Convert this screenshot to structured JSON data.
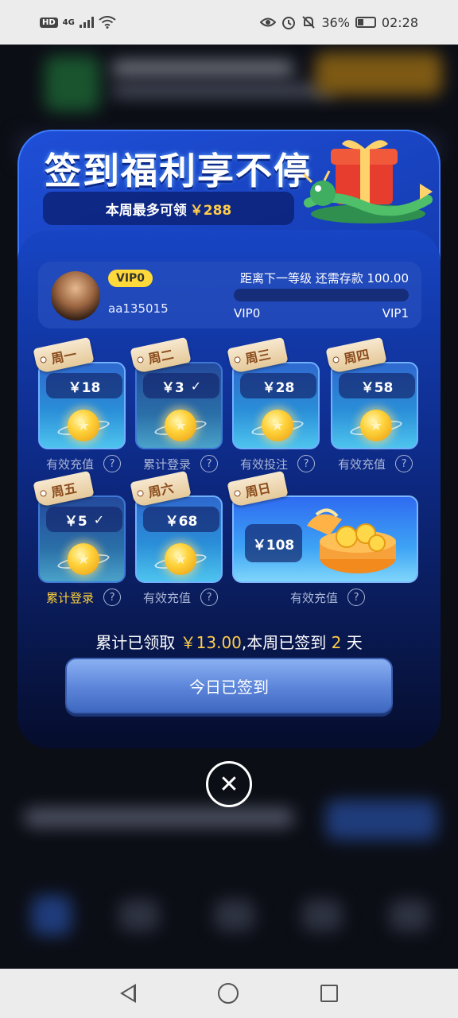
{
  "status_bar": {
    "network": "4G",
    "battery": "36%",
    "time": "02:28"
  },
  "modal": {
    "title": "签到福利享不停",
    "subtitle_prefix": "本周最多可领",
    "subtitle_amount": "￥288",
    "profile": {
      "vip_badge": "VIP0",
      "username": "aa135015",
      "next_level_text": "距离下一等级 还需存款 100.00",
      "level_from": "VIP0",
      "level_to": "VIP1",
      "progress": 0
    },
    "days": [
      {
        "day": "周一",
        "amount": "￥18",
        "signed": false,
        "label": "有效充值"
      },
      {
        "day": "周二",
        "amount": "￥3",
        "signed": true,
        "label": "累计登录"
      },
      {
        "day": "周三",
        "amount": "￥28",
        "signed": false,
        "label": "有效投注"
      },
      {
        "day": "周四",
        "amount": "￥58",
        "signed": false,
        "label": "有效充值"
      },
      {
        "day": "周五",
        "amount": "￥5",
        "signed": true,
        "label": "累计登录"
      },
      {
        "day": "周六",
        "amount": "￥68",
        "signed": false,
        "label": "有效充值"
      },
      {
        "day": "周日",
        "amount": "￥108",
        "signed": false,
        "label": "有效充值"
      }
    ],
    "summary": {
      "prefix": "累计已领取",
      "amount": "￥13.00",
      "middle": ",本周已签到",
      "days": "2",
      "suffix": "天"
    },
    "button_label": "今日已签到",
    "check_glyph": "✓",
    "help_glyph": "?",
    "close_glyph": "✕"
  },
  "colors": {
    "accent_gold": "#ffcc4a",
    "modal_blue": "#1f4fd8",
    "vip_badge": "#ffd93a"
  }
}
